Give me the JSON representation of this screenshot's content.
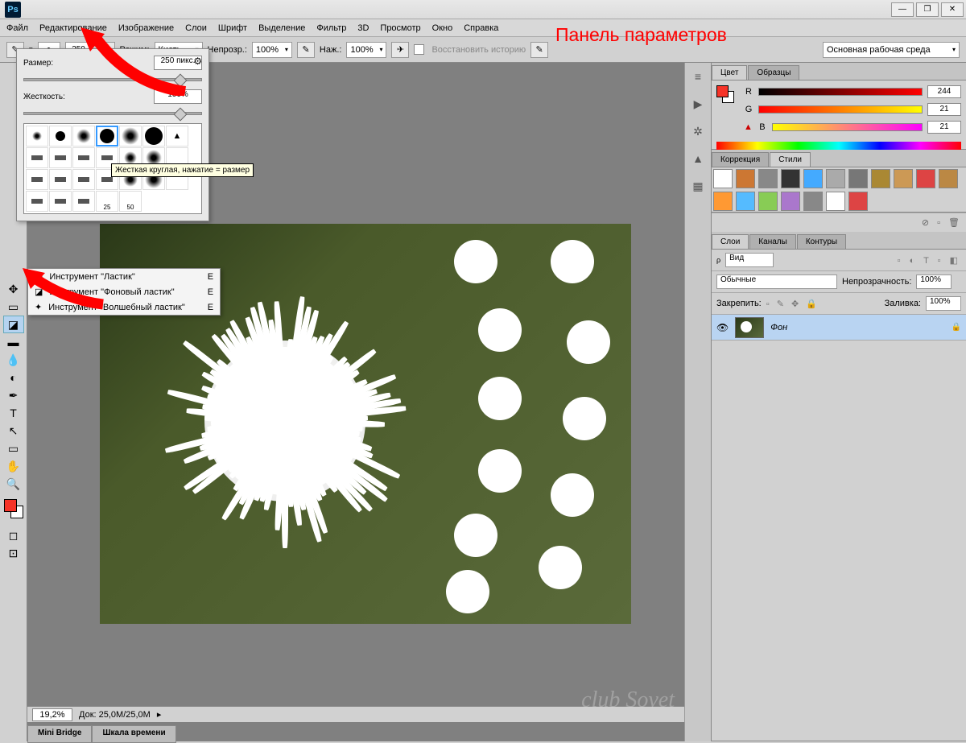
{
  "app": {
    "logo": "Ps",
    "title": ""
  },
  "window": {
    "min": "—",
    "max": "❐",
    "close": "✕"
  },
  "menu": [
    "Файл",
    "Редактирование",
    "Изображение",
    "Слои",
    "Шрифт",
    "Выделение",
    "Фильтр",
    "3D",
    "Просмотр",
    "Окно",
    "Справка"
  ],
  "options": {
    "brush_size": "250",
    "mode_label": "Режим:",
    "mode": "Кисть",
    "opacity_label": "Непрозр.:",
    "opacity": "100%",
    "flow_label": "Наж.:",
    "flow": "100%",
    "restore": "Восстановить историю",
    "workspace": "Основная рабочая среда"
  },
  "annotation": {
    "options_panel": "Панель параметров"
  },
  "brush_popup": {
    "size_label": "Размер:",
    "size": "250 пикс.",
    "hard_label": "Жесткость:",
    "hard": "100%",
    "tooltip": "Жесткая круглая, нажатие = размер",
    "nums": [
      "25",
      "50"
    ]
  },
  "tool_fly": [
    {
      "label": "Инструмент \"Ластик\"",
      "key": "E"
    },
    {
      "label": "Инструмент \"Фоновый ластик\"",
      "key": "E"
    },
    {
      "label": "Инструмент \"Волшебный ластик\"",
      "key": "E"
    }
  ],
  "color": {
    "tab_color": "Цвет",
    "tab_swatches": "Образцы",
    "r_label": "R",
    "g_label": "G",
    "b_label": "B",
    "r": "244",
    "g": "21",
    "b": "21"
  },
  "styles": {
    "tab_corr": "Коррекция",
    "tab_styles": "Стили",
    "colors": [
      "#fff",
      "#c73",
      "#888",
      "#333",
      "#4af",
      "#aaa",
      "#777",
      "#a83",
      "#c95",
      "#d44",
      "#b84",
      "#f93",
      "#5bf",
      "#8c5",
      "#a7c",
      "#888",
      "#fff",
      "#d44"
    ]
  },
  "layers": {
    "tab_layers": "Слои",
    "tab_channels": "Каналы",
    "tab_paths": "Контуры",
    "kind": "Вид",
    "blend": "Обычные",
    "opacity_label": "Непрозрачность:",
    "opacity": "100%",
    "lock_label": "Закрепить:",
    "fill_label": "Заливка:",
    "fill": "100%",
    "layer_name": "Фон"
  },
  "status": {
    "zoom": "19,2%",
    "doc": "Док: 25,0M/25,0M"
  },
  "bottom_tabs": [
    "Mini Bridge",
    "Шкала времени"
  ],
  "watermark": "club Sovet"
}
